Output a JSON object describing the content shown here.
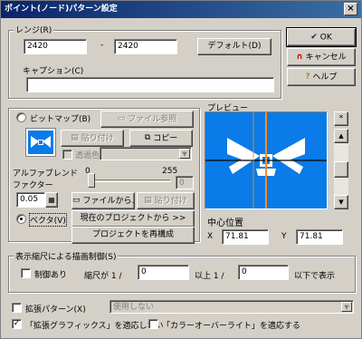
{
  "window": {
    "title": "ポイント(ノード)パターン設定",
    "close_label": "×"
  },
  "range": {
    "group_label": "レンジ(R)",
    "from_value": "2420",
    "separator": "-",
    "to_value": "2420",
    "default_button": "デフォルト(D)"
  },
  "caption": {
    "label": "キャプション(C)",
    "value": ""
  },
  "actions": {
    "ok": "OK",
    "cancel": "キャンセル",
    "help": "ヘルプ"
  },
  "bitmap": {
    "radio_label": "ビットマップ(B)",
    "file_ref_button": "ファイル参照",
    "paste_button": "貼り付け",
    "copy_button": "コピー",
    "transparent_label": "透過色"
  },
  "alpha": {
    "label_line1": "アルファブレンド",
    "label_line2": "ファクター",
    "min": "0",
    "max": "255",
    "value": "0",
    "slider_level": 0
  },
  "vector": {
    "scale_value": "0.05",
    "radio_label": "ベクタ(V)",
    "from_file_button": "ファイルから...",
    "paste_button": "貼り付け",
    "from_project_button": "現在のプロジェクトから >>",
    "reconfigure_button": "プロジェクトを再構成"
  },
  "preview": {
    "label": "プレビュー",
    "star_button": "*",
    "center_label": "中心位置",
    "x_label": "X",
    "x_value": "71.81",
    "y_label": "Y",
    "y_value": "71.81",
    "bg_color": "#0a7be8"
  },
  "scale_control": {
    "group_label": "表示縮尺による描画制御(S)",
    "limit_checkbox": "制御あり",
    "scale_prefix": "縮尺が 1 /",
    "min_value": "0",
    "above_label": "以上 1 /",
    "max_value": "0",
    "below_label": "以下で表示"
  },
  "extended": {
    "checkbox_label": "拡張パターン(X)",
    "select_value": "使用しない",
    "no_graphics_label": "「拡張グラフィックス」を適応しない",
    "no_graphics_checked": true,
    "color_override_label": "「カラーオーバーライト」を適応する",
    "color_override_checked": false
  }
}
